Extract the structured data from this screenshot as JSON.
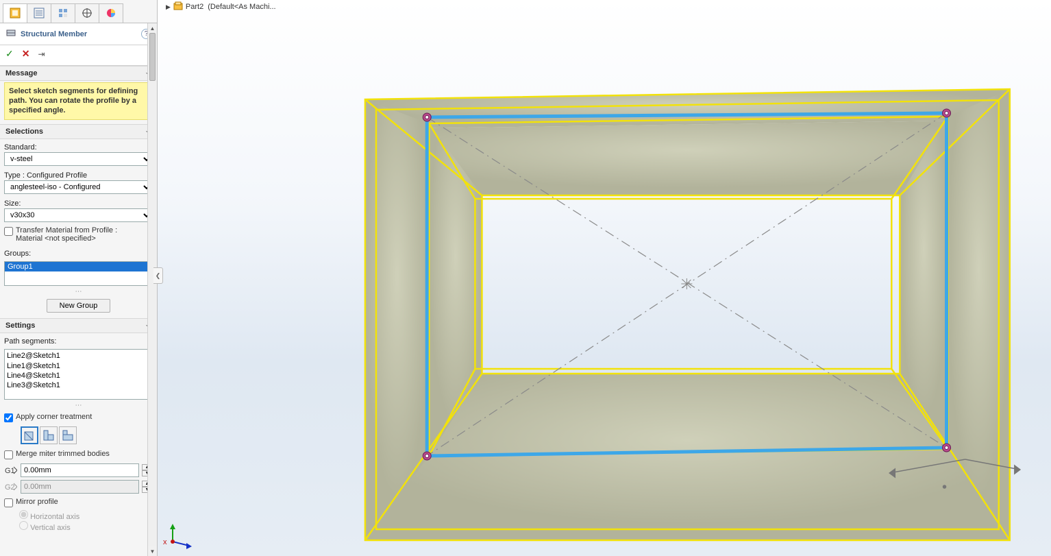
{
  "topBar": {
    "partName": "Part2",
    "config": "(Default<As Machi..."
  },
  "panel": {
    "title": "Structural Member",
    "message_head": "Message",
    "message_text": "Select sketch segments for defining path. You can rotate the profile by a specified angle.",
    "selections_head": "Selections",
    "standard_label": "Standard:",
    "standard_value": "v-steel",
    "type_label": "Type : Configured Profile",
    "type_value": "anglesteel-iso - Configured",
    "size_label": "Size:",
    "size_value": "v30x30",
    "transfer_label_1": "Transfer Material from Profile :",
    "transfer_label_2": "Material <not specified>",
    "groups_label": "Groups:",
    "group_item": "Group1",
    "new_group_btn": "New Group",
    "settings_head": "Settings",
    "path_label": "Path segments:",
    "segments": [
      "Line2@Sketch1",
      "Line1@Sketch1",
      "Line4@Sketch1",
      "Line3@Sketch1"
    ],
    "apply_corner_label": "Apply corner treatment",
    "merge_label": "Merge miter trimmed bodies",
    "gap1_value": "0.00mm",
    "gap2_value": "0.00mm",
    "mirror_label": "Mirror profile",
    "h_axis_label": "Horizontal axis",
    "v_axis_label": "Vertical axis"
  },
  "icons": {
    "ok": "✓",
    "cancel": "✕",
    "pin": "✛",
    "chev": "⌵"
  }
}
